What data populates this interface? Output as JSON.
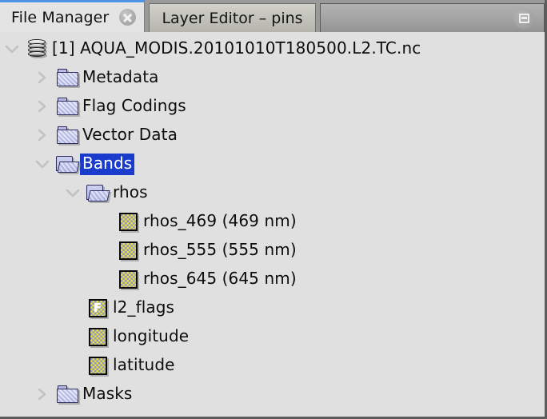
{
  "window": {
    "title": "File Manager"
  },
  "tabs": [
    {
      "label": "File Manager",
      "active": true,
      "closable": true,
      "close_icon": "close-icon"
    },
    {
      "label": "Layer Editor – pins",
      "active": false,
      "closable": false
    }
  ],
  "toolbar": {
    "float_button_name": "float-panel-button",
    "float_button_icon": "window-restore-icon"
  },
  "colors": {
    "panel_background": "#e0e0e0",
    "selection_blue": "#1a3ccc",
    "active_tab_accent": "#4d93e8",
    "tab_bar_background": "#9a9a9a",
    "text": "#0d0d0d"
  },
  "tree": {
    "nodes": [
      {
        "label": "[1] AQUA_MODIS.20101010T180500.L2.TC.nc",
        "icon": "product-database-icon",
        "twisty": "chevron-down-icon",
        "depth": 1,
        "selected": false
      },
      {
        "label": "Metadata",
        "icon": "folder-closed-icon",
        "twisty": "chevron-right-icon",
        "depth": 2,
        "selected": false
      },
      {
        "label": "Flag Codings",
        "icon": "folder-closed-icon",
        "twisty": "chevron-right-icon",
        "depth": 2,
        "selected": false
      },
      {
        "label": "Vector Data",
        "icon": "folder-closed-icon",
        "twisty": "chevron-right-icon",
        "depth": 2,
        "selected": false
      },
      {
        "label": "Bands",
        "icon": "folder-open-icon",
        "twisty": "chevron-down-icon",
        "depth": 2,
        "selected": true
      },
      {
        "label": "rhos",
        "icon": "folder-open-icon",
        "twisty": "chevron-down-icon",
        "depth": 3,
        "selected": false
      },
      {
        "label": "rhos_469 (469 nm)",
        "icon": "raster-band-icon",
        "twisty": "none",
        "depth": 4,
        "selected": false
      },
      {
        "label": "rhos_555 (555 nm)",
        "icon": "raster-band-icon",
        "twisty": "none",
        "depth": 4,
        "selected": false
      },
      {
        "label": "rhos_645 (645 nm)",
        "icon": "raster-band-icon",
        "twisty": "none",
        "depth": 4,
        "selected": false
      },
      {
        "label": "l2_flags",
        "icon": "flag-band-icon",
        "icon_letter": "F",
        "twisty": "none",
        "depth": 3,
        "selected": false
      },
      {
        "label": "longitude",
        "icon": "raster-band-icon",
        "twisty": "none",
        "depth": 3,
        "selected": false
      },
      {
        "label": "latitude",
        "icon": "raster-band-icon",
        "twisty": "none",
        "depth": 3,
        "selected": false
      },
      {
        "label": "Masks",
        "icon": "folder-closed-icon",
        "twisty": "chevron-right-icon",
        "depth": 2,
        "selected": false
      }
    ]
  }
}
